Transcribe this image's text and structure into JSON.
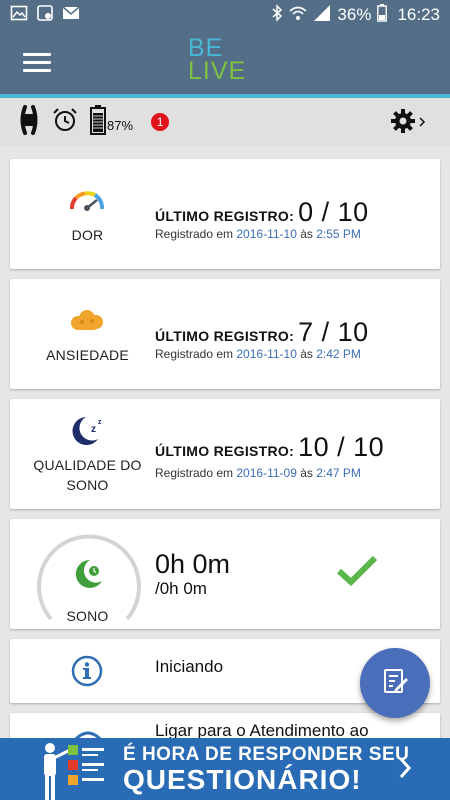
{
  "status_bar": {
    "battery": "36%",
    "time": "16:23"
  },
  "device_bar": {
    "battery_level": "87%",
    "alert_count": "1"
  },
  "cards": [
    {
      "label": "DOR",
      "record_title": "ÚLTIMO REGISTRO:",
      "record_value": "0 / 10",
      "registered_prefix": "Registrado em ",
      "date": "2016-11-10",
      "at": " às ",
      "time": "2:55 PM"
    },
    {
      "label": "ANSIEDADE",
      "record_title": "ÚLTIMO REGISTRO:",
      "record_value": "7 / 10",
      "registered_prefix": "Registrado em ",
      "date": "2016-11-10",
      "at": " às ",
      "time": "2:42 PM"
    },
    {
      "label_line1": "QUALIDADE DO",
      "label_line2": "SONO",
      "record_title": "ÚLTIMO REGISTRO:",
      "record_value": "10 / 10",
      "registered_prefix": "Registrado em ",
      "date": "2016-11-09",
      "at": " às ",
      "time": "2:47 PM"
    }
  ],
  "sleep": {
    "label": "SONO",
    "duration": "0h 0m",
    "goal": "/0h 0m"
  },
  "info": {
    "label": "Iniciando"
  },
  "call": {
    "label": "Ligar para o Atendimento ao"
  },
  "banner": {
    "line1": "É HORA DE RESPONDER SEU",
    "line2": "QUESTIONÁRIO!"
  },
  "colors": {
    "appbar": "#536e86",
    "accent_line": "#49b7d6",
    "date_blue": "#3b6db5",
    "check_green": "#5bb74a",
    "fab": "#4a6eb9",
    "banner": "#2a6bb5"
  }
}
